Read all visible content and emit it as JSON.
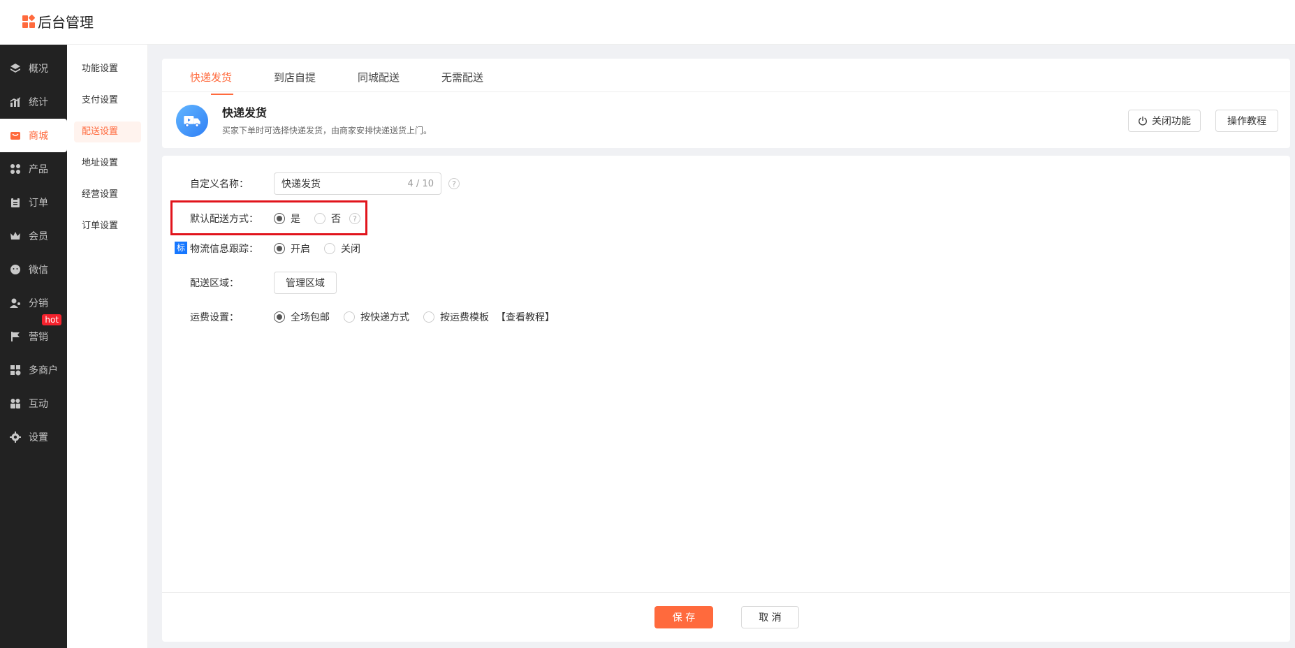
{
  "app": {
    "title": "后台管理"
  },
  "sidebar": {
    "items": [
      {
        "label": "概况",
        "icon": "layers-icon"
      },
      {
        "label": "统计",
        "icon": "chart-icon"
      },
      {
        "label": "商城",
        "icon": "mall-icon",
        "active": true
      },
      {
        "label": "产品",
        "icon": "product-icon"
      },
      {
        "label": "订单",
        "icon": "order-icon"
      },
      {
        "label": "会员",
        "icon": "crown-icon"
      },
      {
        "label": "微信",
        "icon": "wechat-icon"
      },
      {
        "label": "分销",
        "icon": "distribution-icon"
      },
      {
        "label": "营销",
        "icon": "flag-icon",
        "badge": "hot"
      },
      {
        "label": "多商户",
        "icon": "merchant-icon"
      },
      {
        "label": "互动",
        "icon": "interact-icon"
      },
      {
        "label": "设置",
        "icon": "gear-icon"
      }
    ]
  },
  "submenu": {
    "items": [
      "功能设置",
      "支付设置",
      "配送设置",
      "地址设置",
      "经营设置",
      "订单设置"
    ],
    "active_index": 2
  },
  "tabs": [
    "快递发货",
    "到店自提",
    "同城配送",
    "无需配送"
  ],
  "intro": {
    "title": "快递发货",
    "desc": "买家下单时可选择快递发货，由商家安排快递送货上门。"
  },
  "actions": {
    "close_feature": "关闭功能",
    "tutorial": "操作教程"
  },
  "form": {
    "custom_name": {
      "label": "自定义名称：",
      "value": "快递发货",
      "count": "4 / 10"
    },
    "default_method": {
      "label": "默认配送方式：",
      "options": [
        "是",
        "否"
      ],
      "selected": "是"
    },
    "logistics_tracking": {
      "tag": "标",
      "label": "物流信息跟踪：",
      "options": [
        "开启",
        "关闭"
      ],
      "selected": "开启"
    },
    "delivery_area": {
      "label": "配送区域：",
      "button": "管理区域"
    },
    "freight": {
      "label": "运费设置：",
      "options": [
        "全场包邮",
        "按快递方式",
        "按运费模板"
      ],
      "selected": "全场包邮",
      "link": "【查看教程】"
    }
  },
  "footer": {
    "save": "保 存",
    "cancel": "取 消"
  },
  "colors": {
    "accent": "#ff6a3d",
    "sidebar_bg": "#222222",
    "highlight": "#e1141c"
  }
}
